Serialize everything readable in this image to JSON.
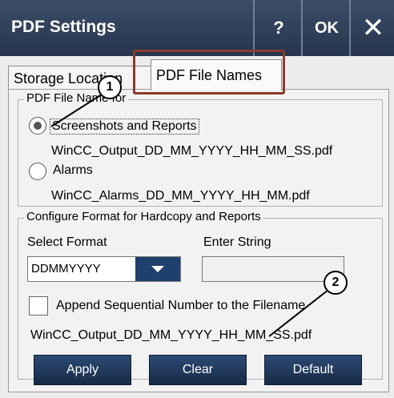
{
  "window": {
    "title": "PDF Settings",
    "help_label": "?",
    "ok_label": "OK",
    "close_label": "✕"
  },
  "tabs": [
    {
      "label": "Storage Location"
    },
    {
      "label": "PDF File Names"
    }
  ],
  "pdf_file_name_group": {
    "legend": "PDF File Name for",
    "option1_label": "Screenshots and Reports",
    "option1_filename": "WinCC_Output_DD_MM_YYYY_HH_MM_SS.pdf",
    "option2_label": "Alarms",
    "option2_filename": "WinCC_Alarms_DD_MM_YYYY_HH_MM.pdf"
  },
  "format_group": {
    "legend": "Configure Format for Hardcopy and Reports",
    "select_format_label": "Select Format",
    "select_format_value": "DDMMYYYY",
    "enter_string_label": "Enter String",
    "enter_string_value": "",
    "append_label": "Append Sequential Number to the Filename",
    "preview_filename": "WinCC_Output_DD_MM_YYYY_HH_MM_SS.pdf"
  },
  "buttons": {
    "apply": "Apply",
    "clear": "Clear",
    "default": "Default"
  },
  "callouts": {
    "one": "1",
    "two": "2"
  }
}
